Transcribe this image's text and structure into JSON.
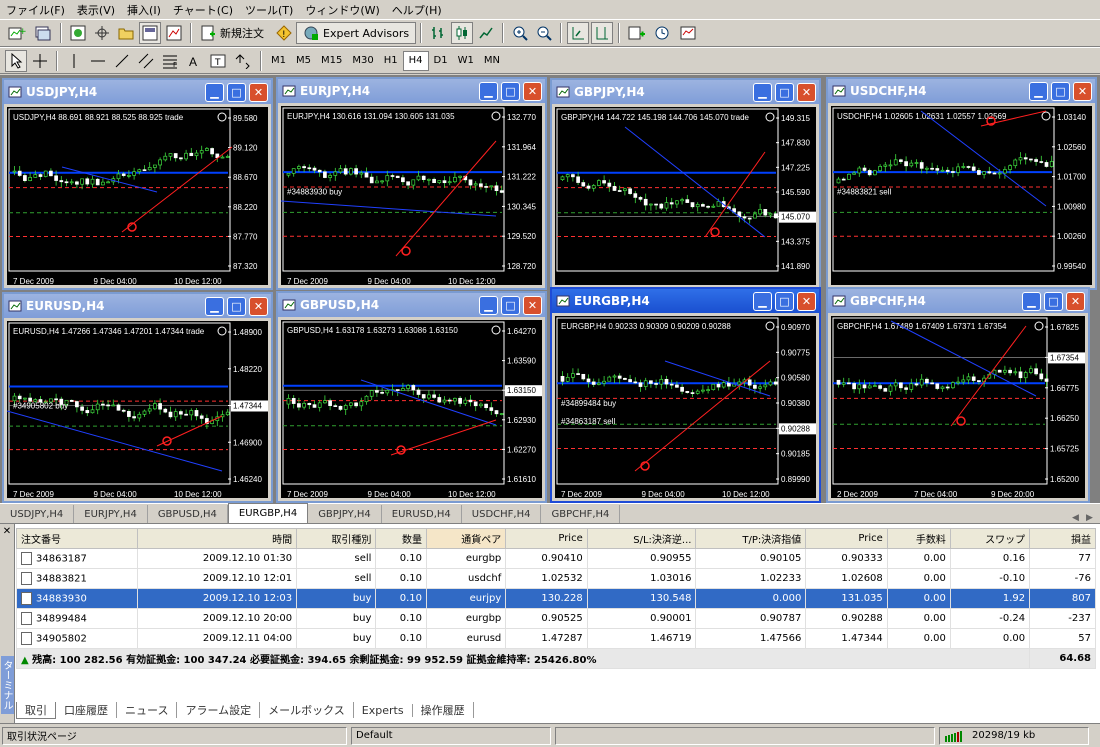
{
  "menu": [
    "ファイル(F)",
    "表示(V)",
    "挿入(I)",
    "チャート(C)",
    "ツール(T)",
    "ウィンドウ(W)",
    "ヘルプ(H)"
  ],
  "toolbar": {
    "new_order": "新規注文",
    "expert_advisors": "Expert Advisors",
    "timeframes": [
      "M1",
      "M5",
      "M15",
      "M30",
      "H1",
      "H4",
      "D1",
      "W1",
      "MN"
    ],
    "active_timeframe": "H4"
  },
  "charts": [
    {
      "title": "USDJPY,H4",
      "header": "USDJPY,H4  88.691 88.921 88.525 88.925",
      "subheader": "trade",
      "prices": [
        "89.580",
        "89.120",
        "88.670",
        "88.220",
        "87.770",
        "87.320"
      ],
      "current": "88.925",
      "dates": [
        "7 Dec 2009",
        "9 Dec 04:00",
        "10 Dec 12:00"
      ]
    },
    {
      "title": "EURJPY,H4",
      "header": "EURJPY,H4  130.616 131.094 130.605 131.035",
      "subheader": "",
      "prices": [
        "132.770",
        "131.964",
        "131.222",
        "130.345",
        "129.520",
        "128.720"
      ],
      "current": "131.035",
      "order_label": "#34883930 buy",
      "dates": [
        "7 Dec 2009",
        "9 Dec 04:00",
        "10 Dec 12:00"
      ]
    },
    {
      "title": "GBPJPY,H4",
      "header": "GBPJPY,H4  144.722 145.198 144.706 145.070",
      "subheader": "trade",
      "prices": [
        "149.315",
        "147.830",
        "147.225",
        "145.590",
        "145.070",
        "143.375",
        "141.890"
      ],
      "current": "145.070",
      "dates": []
    },
    {
      "title": "USDCHF,H4",
      "header": "USDCHF,H4  1.02605 1.02631 1.02557 1.02569",
      "subheader": "",
      "prices": [
        "1.03140",
        "1.02560",
        "1.01700",
        "1.00980",
        "1.00260",
        "0.99540"
      ],
      "current": "1.02569",
      "order_label": "#34883821 sell",
      "dates": []
    },
    {
      "title": "EURUSD,H4",
      "header": "EURUSD,H4  1.47266 1.47346 1.47201 1.47344",
      "subheader": "trade",
      "prices": [
        "1.48900",
        "1.48220",
        "1.47344",
        "1.46900",
        "1.46240"
      ],
      "current": "1.47344",
      "order_label": "#34905802 buy",
      "dates": [
        "7 Dec 2009",
        "9 Dec 04:00",
        "10 Dec 12:00"
      ]
    },
    {
      "title": "GBPUSD,H4",
      "header": "GBPUSD,H4  1.63178 1.63273 1.63086 1.63150",
      "subheader": "",
      "prices": [
        "1.64270",
        "1.63590",
        "1.63150",
        "1.62930",
        "1.62270",
        "1.61610"
      ],
      "current": "1.63150",
      "dates": [
        "7 Dec 2009",
        "9 Dec 04:00",
        "10 Dec 12:00"
      ]
    },
    {
      "title": "EURGBP,H4",
      "header": "EURGBP,H4  0.90233 0.90309 0.90209 0.90288",
      "subheader": "",
      "prices": [
        "0.90970",
        "0.90775",
        "0.90580",
        "0.90380",
        "0.90288",
        "0.90185",
        "0.89990"
      ],
      "current": "0.90288",
      "order_label": "#34899484 buy",
      "order_label2": "#34863187 sell",
      "dates": [
        "7 Dec 2009",
        "9 Dec 04:00",
        "10 Dec 12:00"
      ]
    },
    {
      "title": "GBPCHF,H4",
      "header": "GBPCHF,H4  1.67489 1.67409 1.67371 1.67354",
      "subheader": "",
      "prices": [
        "1.67825",
        "1.67354",
        "1.66775",
        "1.66250",
        "1.65725",
        "1.65200"
      ],
      "current": "1.67354",
      "dates": [
        "2 Dec 2009",
        "7 Dec 04:00",
        "9 Dec 20:00"
      ]
    }
  ],
  "chart_tabs": [
    "USDJPY,H4",
    "EURJPY,H4",
    "GBPUSD,H4",
    "EURGBP,H4",
    "GBPJPY,H4",
    "EURUSD,H4",
    "USDCHF,H4",
    "GBPCHF,H4"
  ],
  "active_chart_tab": "EURGBP,H4",
  "orders": {
    "columns": [
      "注文番号",
      "時間",
      "取引種別",
      "数量",
      "通貨ペア",
      "Price",
      "S/L:決済逆...",
      "T/P:決済指値",
      "Price",
      "手数料",
      "スワップ",
      "損益"
    ],
    "rows": [
      [
        "34863187",
        "2009.12.10 01:30",
        "sell",
        "0.10",
        "eurgbp",
        "0.90410",
        "0.90955",
        "0.90105",
        "0.90333",
        "0.00",
        "0.16",
        "77"
      ],
      [
        "34883821",
        "2009.12.10 12:01",
        "sell",
        "0.10",
        "usdchf",
        "1.02532",
        "1.03016",
        "1.02233",
        "1.02608",
        "0.00",
        "-0.10",
        "-76"
      ],
      [
        "34883930",
        "2009.12.10 12:03",
        "buy",
        "0.10",
        "eurjpy",
        "130.228",
        "130.548",
        "0.000",
        "131.035",
        "0.00",
        "1.92",
        "807"
      ],
      [
        "34899484",
        "2009.12.10 20:00",
        "buy",
        "0.10",
        "eurgbp",
        "0.90525",
        "0.90001",
        "0.90787",
        "0.90288",
        "0.00",
        "-0.24",
        "-237"
      ],
      [
        "34905802",
        "2009.12.11 04:00",
        "buy",
        "0.10",
        "eurusd",
        "1.47287",
        "1.46719",
        "1.47566",
        "1.47344",
        "0.00",
        "0.00",
        "57"
      ]
    ],
    "selected_row": 2,
    "balance_line": "残高: 100 282.56  有効証拠金: 100 347.24  必要証拠金: 394.65  余剰証拠金: 99 952.59  証拠金維持率: 25426.80%",
    "balance_total": "64.68"
  },
  "terminal_tabs": [
    "取引",
    "口座履歴",
    "ニュース",
    "アラーム設定",
    "メールボックス",
    "Experts",
    "操作履歴"
  ],
  "terminal_label": "ターミナル",
  "status": {
    "left": "取引状況ページ",
    "profile": "Default",
    "traffic": "20298/19 kb"
  }
}
